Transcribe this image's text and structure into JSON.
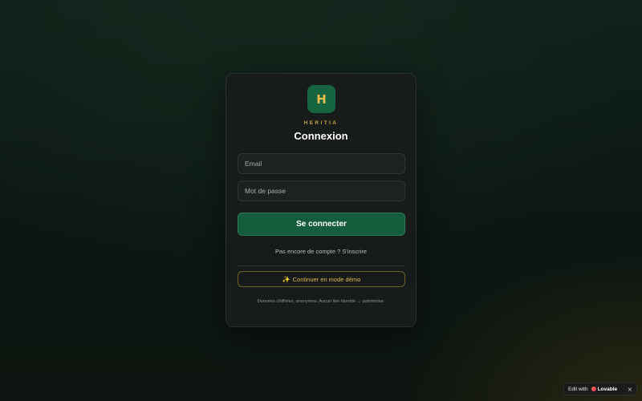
{
  "brand": {
    "logo_letter": "H",
    "name": "HERITIA",
    "logo_bg": "#176443",
    "logo_fg": "#e9c04d"
  },
  "login": {
    "title": "Connexion",
    "email_placeholder": "Email",
    "password_placeholder": "Mot de passe",
    "submit_label": "Se connecter",
    "signup_text": "Pas encore de compte ? S'inscrire",
    "demo_icon": "sparkles-icon",
    "demo_emoji": "✨",
    "demo_label": "Continuer en mode démo",
    "privacy_note": "Données chiffrées, anonymes. Aucun lien identité ↔ patrimoine."
  },
  "badge": {
    "edit_label": "Edit with",
    "brand_label": "Lovable",
    "close_glyph": "×"
  },
  "colors": {
    "primary": "#155c3d",
    "accent_gold": "#e0b94a",
    "card_bg": "#181c1a"
  }
}
